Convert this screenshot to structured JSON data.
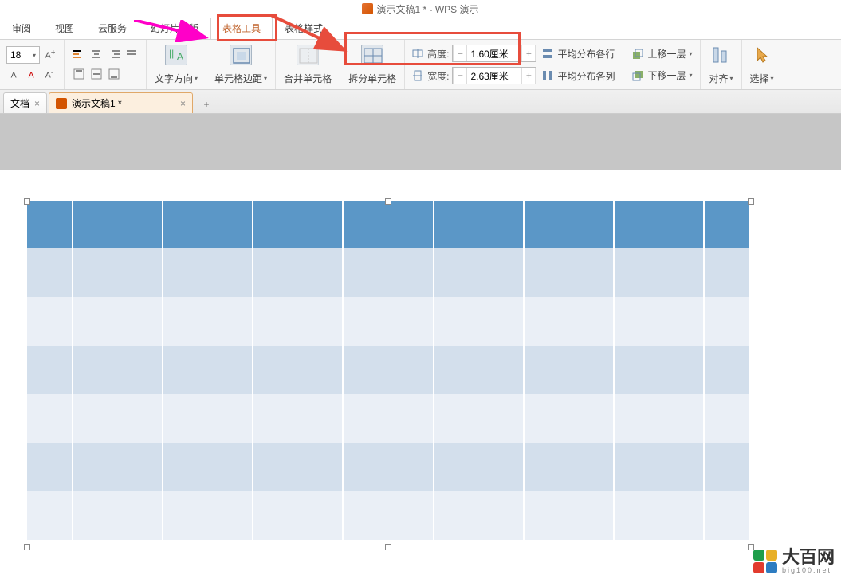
{
  "title": "演示文稿1 * - WPS 演示",
  "menu": [
    "审阅",
    "视图",
    "云服务",
    "幻灯片母版",
    "表格工具",
    "表格样式"
  ],
  "menu_active": 4,
  "fontsize": "18",
  "text_direction_label": "文字方向",
  "cell_margin_label": "单元格边距",
  "merge_label": "合并单元格",
  "split_label": "拆分单元格",
  "height_label": "高度:",
  "width_label": "宽度:",
  "height_value": "1.60厘米",
  "width_value": "2.63厘米",
  "distribute_rows": "平均分布各行",
  "distribute_cols": "平均分布各列",
  "move_up": "上移一层",
  "move_down": "下移一层",
  "align_label": "对齐",
  "select_label": "选择",
  "tabs": [
    {
      "label": "文档",
      "close": true,
      "active": false
    },
    {
      "label": "演示文稿1 *",
      "close": true,
      "active": true
    }
  ],
  "minus": "−",
  "plus": "+",
  "close": "×",
  "add": "+",
  "watermark_title": "大百网",
  "watermark_sub": "big100.net"
}
